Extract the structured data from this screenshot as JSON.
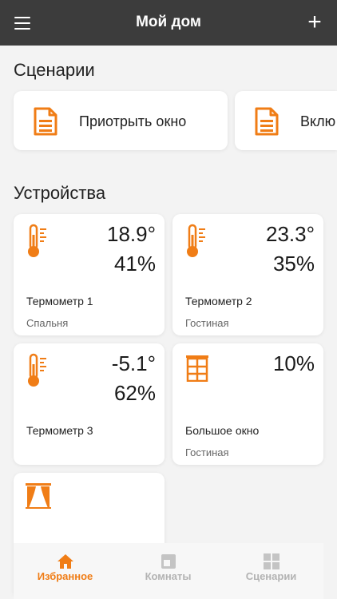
{
  "colors": {
    "accent": "#f07d16",
    "topbar": "#3c3c3c",
    "background": "#f3f3f3"
  },
  "header": {
    "title": "Мой дом",
    "menu_icon": "hamburger-icon",
    "add_icon": "plus-icon",
    "add_label": "+"
  },
  "scenarios": {
    "title": "Сценарии",
    "items": [
      {
        "label": "Приотрыть окно",
        "icon": "document-icon"
      },
      {
        "label": "Вклю",
        "icon": "document-icon"
      }
    ]
  },
  "devices": {
    "title": "Устройства",
    "items": [
      {
        "name": "Термометр 1",
        "room": "Спальня",
        "temperature": "18.9°",
        "humidity": "41%",
        "icon": "thermometer-icon"
      },
      {
        "name": "Термометр 2",
        "room": "Гостиная",
        "temperature": "23.3°",
        "humidity": "35%",
        "icon": "thermometer-icon"
      },
      {
        "name": "Термометр 3",
        "room": "",
        "temperature": "-5.1°",
        "humidity": "62%",
        "icon": "thermometer-icon"
      },
      {
        "name": "Большое окно",
        "room": "Гостиная",
        "value": "10%",
        "icon": "window-icon"
      },
      {
        "name": "",
        "room": "",
        "icon": "curtains-icon"
      }
    ]
  },
  "bottom_nav": {
    "items": [
      {
        "label": "Избранное",
        "icon": "home-icon",
        "active": true
      },
      {
        "label": "Комнаты",
        "icon": "rooms-icon",
        "active": false
      },
      {
        "label": "Сценарии",
        "icon": "grid-icon",
        "active": false
      }
    ]
  }
}
